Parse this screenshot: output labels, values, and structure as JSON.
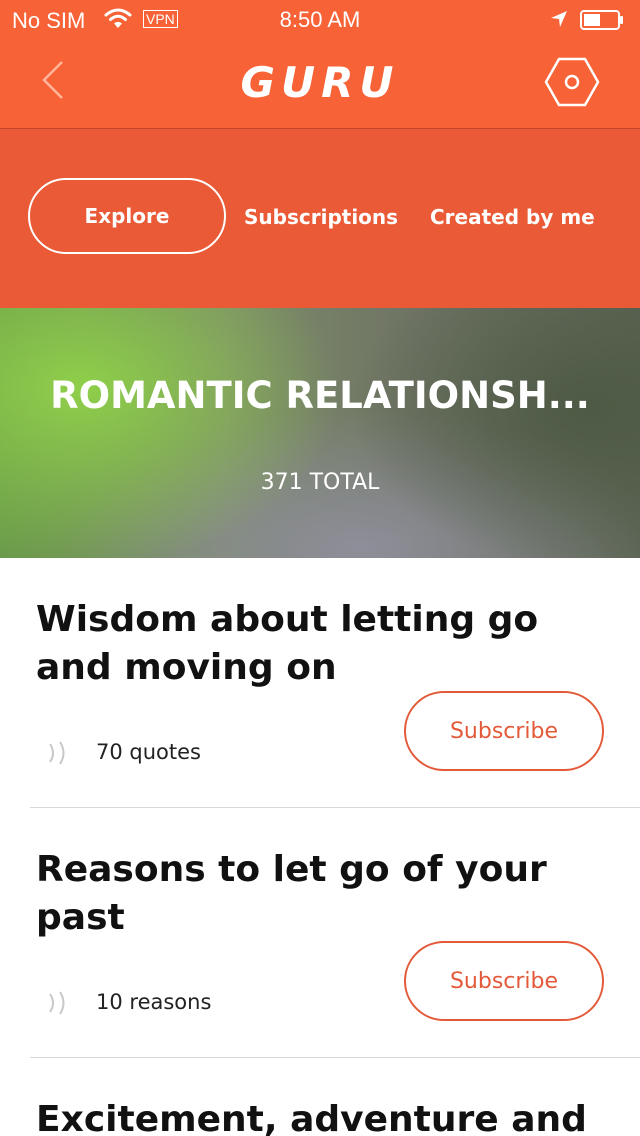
{
  "status_bar": {
    "carrier": "No SIM",
    "vpn": "VPN",
    "time": "8:50 AM"
  },
  "nav": {
    "logo": "GURU"
  },
  "tabs": [
    {
      "label": "Explore",
      "active": true
    },
    {
      "label": "Subscriptions",
      "active": false
    },
    {
      "label": "Created by me",
      "active": false
    }
  ],
  "hero": {
    "title": "ROMANTIC RELATIONSH...",
    "total": "371 TOTAL"
  },
  "items": [
    {
      "title": "Wisdom about letting go and moving on",
      "count": "70 quotes",
      "button": "Subscribe"
    },
    {
      "title": "Reasons to let go of your past",
      "count": "10 reasons",
      "button": "Subscribe"
    },
    {
      "title": "Excitement, adventure and",
      "count": "",
      "button": ""
    }
  ],
  "colors": {
    "brand_orange": "#f76237",
    "tab_bar": "#ea5a36",
    "button_outline": "#e35a3a"
  },
  "icons": {
    "back": "chevron-left-icon",
    "settings": "hexagon-settings-icon",
    "count": "sound-waves-icon"
  }
}
